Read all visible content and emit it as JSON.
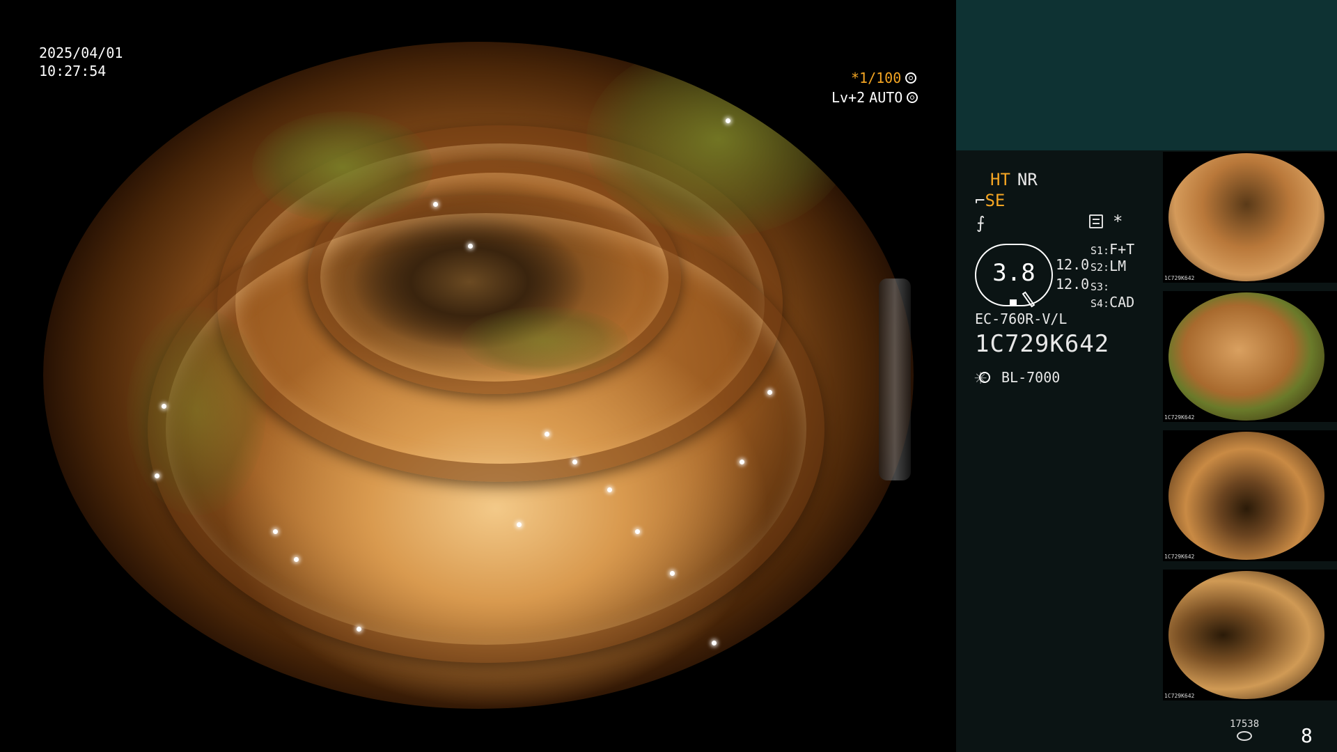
{
  "overlay": {
    "date": "2025/04/01",
    "time": "10:27:54",
    "shutter": "*1/100",
    "iris_level": "Lv+2",
    "iris_mode": "AUTO"
  },
  "panel": {
    "mode_ht": "HT",
    "mode_nr": "NR",
    "se_label": "SE",
    "se_glyph": "⌐",
    "zoom_glyph": "⨍",
    "asterisk": "*",
    "gauge_value": "3.8",
    "gain_1": "12.0",
    "gain_2": "12.0",
    "switches": [
      {
        "key": "S1:",
        "value": "F+T"
      },
      {
        "key": "S2:",
        "value": "LM"
      },
      {
        "key": "S3:",
        "value": ""
      },
      {
        "key": "S4:",
        "value": "CAD"
      }
    ],
    "scope_model": "EC-760R-V/L",
    "serial": "1C729K642",
    "light_source": "BL-7000"
  },
  "thumbnails": [
    {
      "label": "1C729K642"
    },
    {
      "label": "1C729K642"
    },
    {
      "label": "1C729K642"
    },
    {
      "label": "1C729K642"
    }
  ],
  "footer": {
    "storage_count": "17538",
    "image_count": "8"
  },
  "colors": {
    "accent_orange": "#f5a623",
    "panel_top": "#0e3233",
    "panel_bottom": "#0b1414"
  }
}
